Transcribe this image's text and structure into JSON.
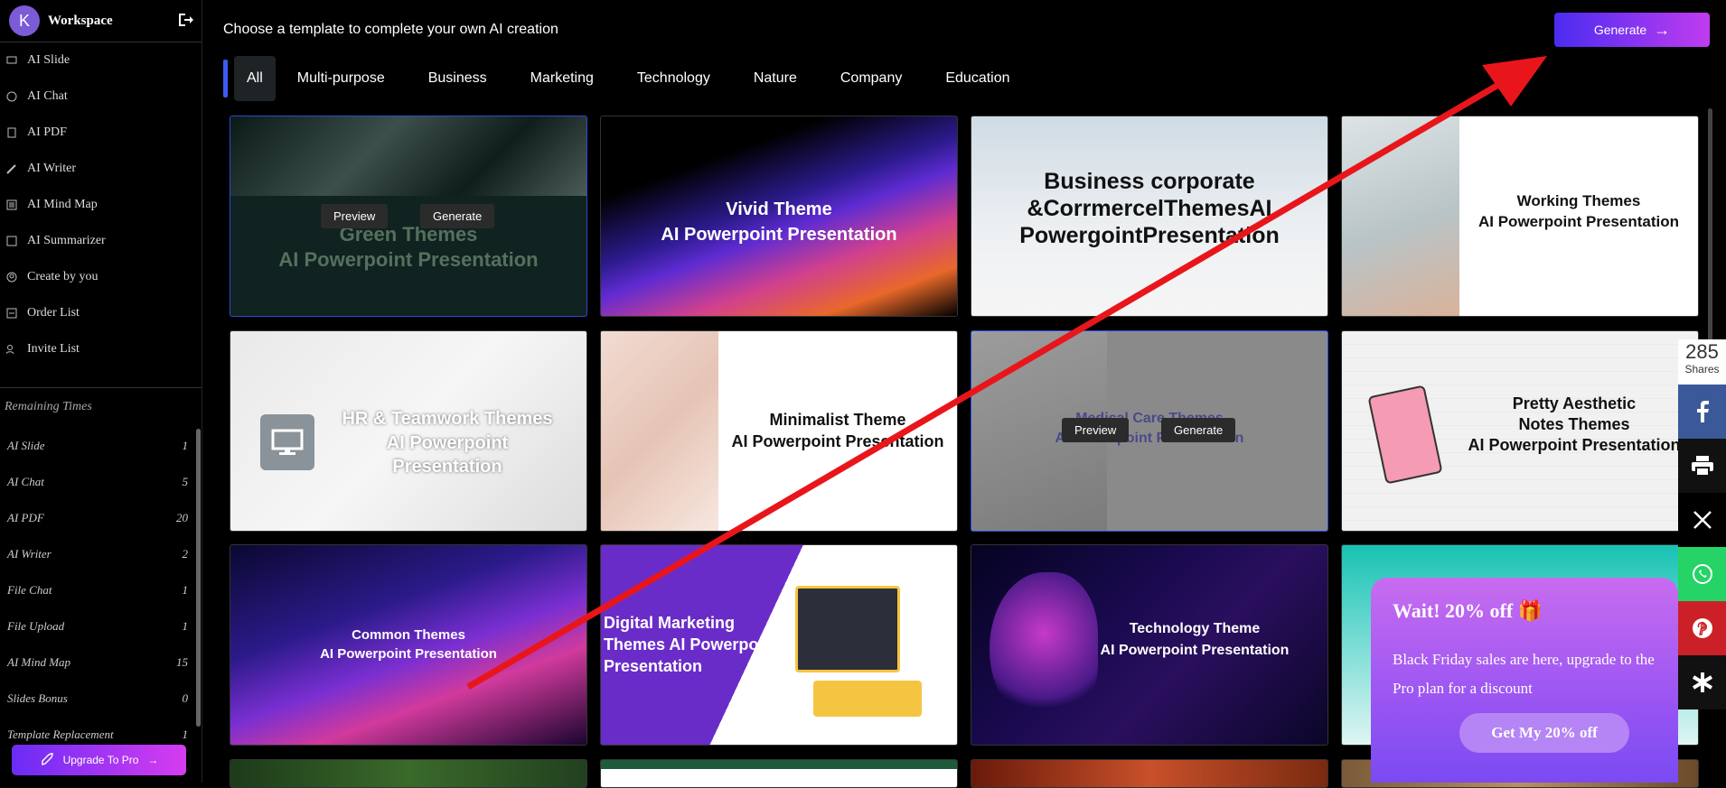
{
  "workspace": {
    "avatar_letter": "K",
    "title": "Workspace"
  },
  "sidebar": {
    "items": [
      {
        "label": "AI Slide",
        "icon": "slide-icon"
      },
      {
        "label": "AI Chat",
        "icon": "chat-icon"
      },
      {
        "label": "AI PDF",
        "icon": "pdf-icon"
      },
      {
        "label": "AI Writer",
        "icon": "pen-icon"
      },
      {
        "label": "AI Mind Map",
        "icon": "mindmap-icon"
      },
      {
        "label": "AI Summarizer",
        "icon": "summarizer-icon"
      },
      {
        "label": "Create by you",
        "icon": "user-circle-icon"
      },
      {
        "label": "Order List",
        "icon": "order-icon"
      },
      {
        "label": "Invite List",
        "icon": "invite-icon"
      }
    ],
    "remaining_title": "Remaining Times",
    "remaining": [
      {
        "label": "AI Slide",
        "value": "1"
      },
      {
        "label": "AI Chat",
        "value": "5"
      },
      {
        "label": "AI PDF",
        "value": "20"
      },
      {
        "label": "AI Writer",
        "value": "2"
      },
      {
        "label": "File Chat",
        "value": "1"
      },
      {
        "label": "File Upload",
        "value": "1"
      },
      {
        "label": "AI Mind Map",
        "value": "15"
      },
      {
        "label": "Slides Bonus",
        "value": "0"
      },
      {
        "label": "Template Replacement",
        "value": "1"
      }
    ],
    "upgrade_label": "Upgrade To Pro"
  },
  "header": {
    "title": "Choose a template to complete your own AI creation",
    "generate_label": "Generate"
  },
  "tabs": [
    "All",
    "Multi-purpose",
    "Business",
    "Marketing",
    "Technology",
    "Nature",
    "Company",
    "Education"
  ],
  "active_tab": "All",
  "cards": [
    {
      "title1": "Green Themes",
      "title2": "AI Powerpoint Presentation"
    },
    {
      "title1": "Vivid Theme",
      "title2": "AI Powerpoint Presentation"
    },
    {
      "title1": "Business corporate",
      "title2": "&CorrmercelThemesAI",
      "title3": "PowergointPresentation"
    },
    {
      "title1": "Working Themes",
      "title2": "AI Powerpoint Presentation"
    },
    {
      "title1": "HR & Teamwork Themes",
      "title2": "AI Powerpoint",
      "title3": "Presentation"
    },
    {
      "title1": "Minimalist Theme",
      "title2": "AI Powerpoint Presentation"
    },
    {
      "title1": "Medical Care Themes",
      "title2": "AI Powerpoint Presentation"
    },
    {
      "title1": "Pretty Aesthetic",
      "title2": "Notes Themes",
      "title3": "AI Powerpoint Presentation"
    },
    {
      "title1": "Common Themes",
      "title2": "AI Powerpoint Presentation"
    },
    {
      "title1": "Digital Marketing",
      "title2": "Themes AI Powerpoint",
      "title3": "Presentation"
    },
    {
      "title1": "Technology Theme",
      "title2": "AI Powerpoint Presentation"
    }
  ],
  "card_actions": {
    "preview": "Preview",
    "generate": "Generate"
  },
  "share": {
    "count": "285",
    "label": "Shares"
  },
  "promo": {
    "title": "Wait! 20% off 🎁",
    "text1": "Black Friday sales are here, upgrade to the",
    "text2": "Pro plan for a discount",
    "cta": "Get My 20% off"
  },
  "colors": {
    "accent": "#4b2cf0",
    "accent2": "#c03cf0",
    "arrow": "#e8161b"
  }
}
